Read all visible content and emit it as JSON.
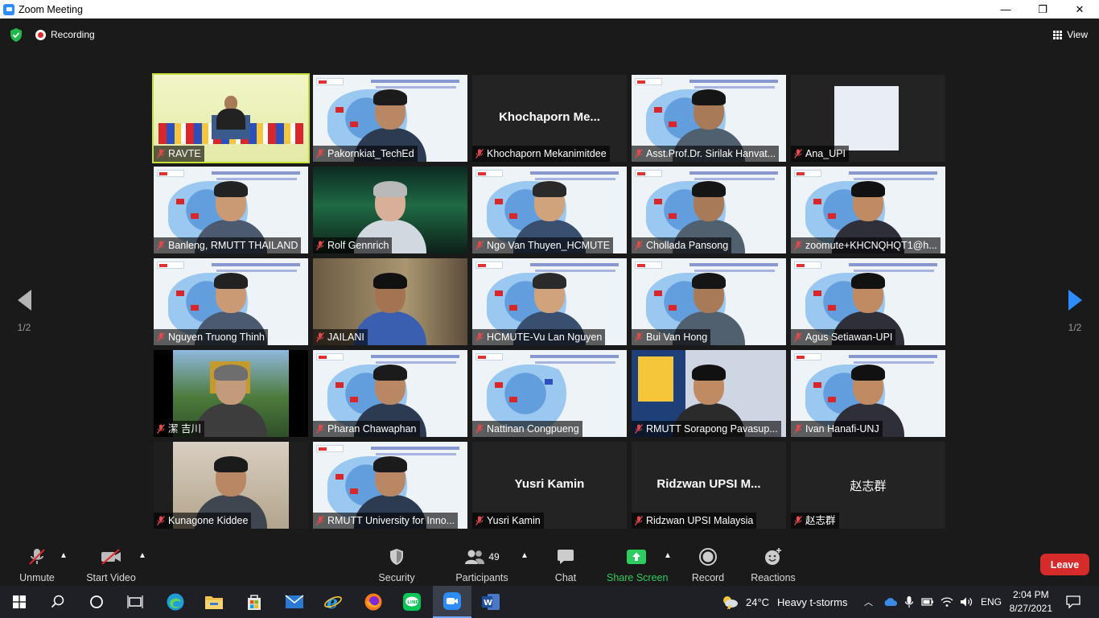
{
  "window": {
    "title": "Zoom Meeting",
    "minimize": "—",
    "maximize": "❐",
    "close": "✕"
  },
  "topbar": {
    "recording_label": "Recording",
    "view_label": "View"
  },
  "page_nav": {
    "left_label": "1/2",
    "right_label": "1/2"
  },
  "participants": [
    {
      "name": "RAVTE",
      "video": true,
      "bg": "stage"
    },
    {
      "name": "Pakornkiat_TechEd",
      "video": true,
      "bg": "slide"
    },
    {
      "name": "Khochaporn Mekanimitdee",
      "video": false,
      "display": "Khochaporn  Me..."
    },
    {
      "name": "Asst.Prof.Dr. Sirilak Hanvat...",
      "video": true,
      "bg": "slide"
    },
    {
      "name": "Ana_UPI",
      "video": true,
      "bg": "dark-slide"
    },
    {
      "name": "Banleng, RMUTT THAILAND",
      "video": true,
      "bg": "slide"
    },
    {
      "name": "Rolf Gennrich",
      "video": true,
      "bg": "aurora"
    },
    {
      "name": "Ngo Van Thuyen_HCMUTE",
      "video": true,
      "bg": "slide"
    },
    {
      "name": "Chollada Pansong",
      "video": true,
      "bg": "slide"
    },
    {
      "name": "zoomute+KHCNQHQT1@h...",
      "video": true,
      "bg": "slide"
    },
    {
      "name": "Nguyen Truong Thinh",
      "video": true,
      "bg": "slide"
    },
    {
      "name": "JAILANI",
      "video": true,
      "bg": "room"
    },
    {
      "name": "HCMUTE-Vu Lan Nguyen",
      "video": true,
      "bg": "slide"
    },
    {
      "name": "Bui Van Hong",
      "video": true,
      "bg": "slide"
    },
    {
      "name": "Agus Setiawan-UPI",
      "video": true,
      "bg": "slide"
    },
    {
      "name": "潔 吉川",
      "video": true,
      "bg": "temple"
    },
    {
      "name": "Pharan Chawaphan",
      "video": true,
      "bg": "slide"
    },
    {
      "name": "Nattinan Congpueng",
      "video": true,
      "bg": "slide-only"
    },
    {
      "name": "RMUTT Sorapong Pavasup...",
      "video": true,
      "bg": "poster"
    },
    {
      "name": "Ivan Hanafi-UNJ",
      "video": true,
      "bg": "slide"
    },
    {
      "name": "Kunagone Kiddee",
      "video": true,
      "bg": "room2"
    },
    {
      "name": "RMUTT University for Inno...",
      "video": true,
      "bg": "slide"
    },
    {
      "name": "Yusri Kamin",
      "video": false,
      "display": "Yusri Kamin"
    },
    {
      "name": "Ridzwan UPSI Malaysia",
      "video": false,
      "display": "Ridzwan  UPSI  M..."
    },
    {
      "name": "赵志群",
      "video": false,
      "display": "赵志群"
    }
  ],
  "toolbar": {
    "unmute": "Unmute",
    "start_video": "Start Video",
    "security": "Security",
    "participants": "Participants",
    "participants_count": "49",
    "chat": "Chat",
    "share_screen": "Share Screen",
    "record": "Record",
    "reactions": "Reactions",
    "leave": "Leave"
  },
  "taskbar": {
    "weather_temp": "24°C",
    "weather_desc": "Heavy t-storms",
    "lang": "ENG",
    "time": "2:04 PM",
    "date": "8/27/2021"
  },
  "colors": {
    "active_speaker": "#c6e03a",
    "share_green": "#2ccd5e",
    "leave_red": "#d52b2b",
    "zoom_blue": "#2d8cff"
  }
}
